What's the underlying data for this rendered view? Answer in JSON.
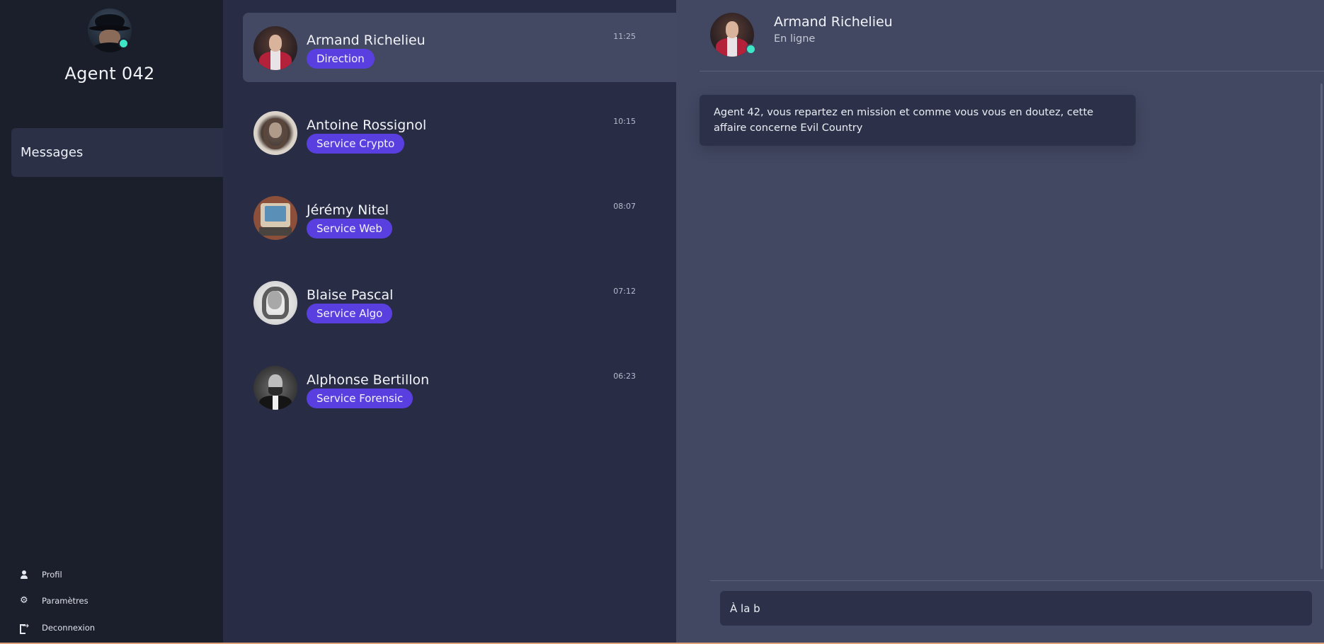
{
  "sidebar": {
    "agent_name": "Agent 042",
    "nav_messages": "Messages",
    "links": {
      "profil": "Profil",
      "parametres": "Paramètres",
      "deconnexion": "Deconnexion"
    }
  },
  "conversations": [
    {
      "name": "Armand Richelieu",
      "badge": "Direction",
      "time": "11:25",
      "active": true
    },
    {
      "name": "Antoine Rossignol",
      "badge": "Service Crypto",
      "time": "10:15"
    },
    {
      "name": "Jérémy Nitel",
      "badge": "Service Web",
      "time": "08:07"
    },
    {
      "name": "Blaise Pascal",
      "badge": "Service Algo",
      "time": "07:12"
    },
    {
      "name": "Alphonse Bertillon",
      "badge": "Service Forensic",
      "time": "06:23"
    }
  ],
  "chat": {
    "contact_name": "Armand Richelieu",
    "status": "En ligne",
    "messages": [
      {
        "text": "Agent 42, vous repartez en mission et comme vous vous en doutez, cette affaire concerne Evil Country"
      }
    ],
    "input_value": "À la b"
  },
  "colors": {
    "accent": "#5a3fe0",
    "online": "#3ee6c8",
    "sidebar_bg": "#1b1f2c",
    "list_bg": "#282d45",
    "chat_bg": "#424862"
  }
}
